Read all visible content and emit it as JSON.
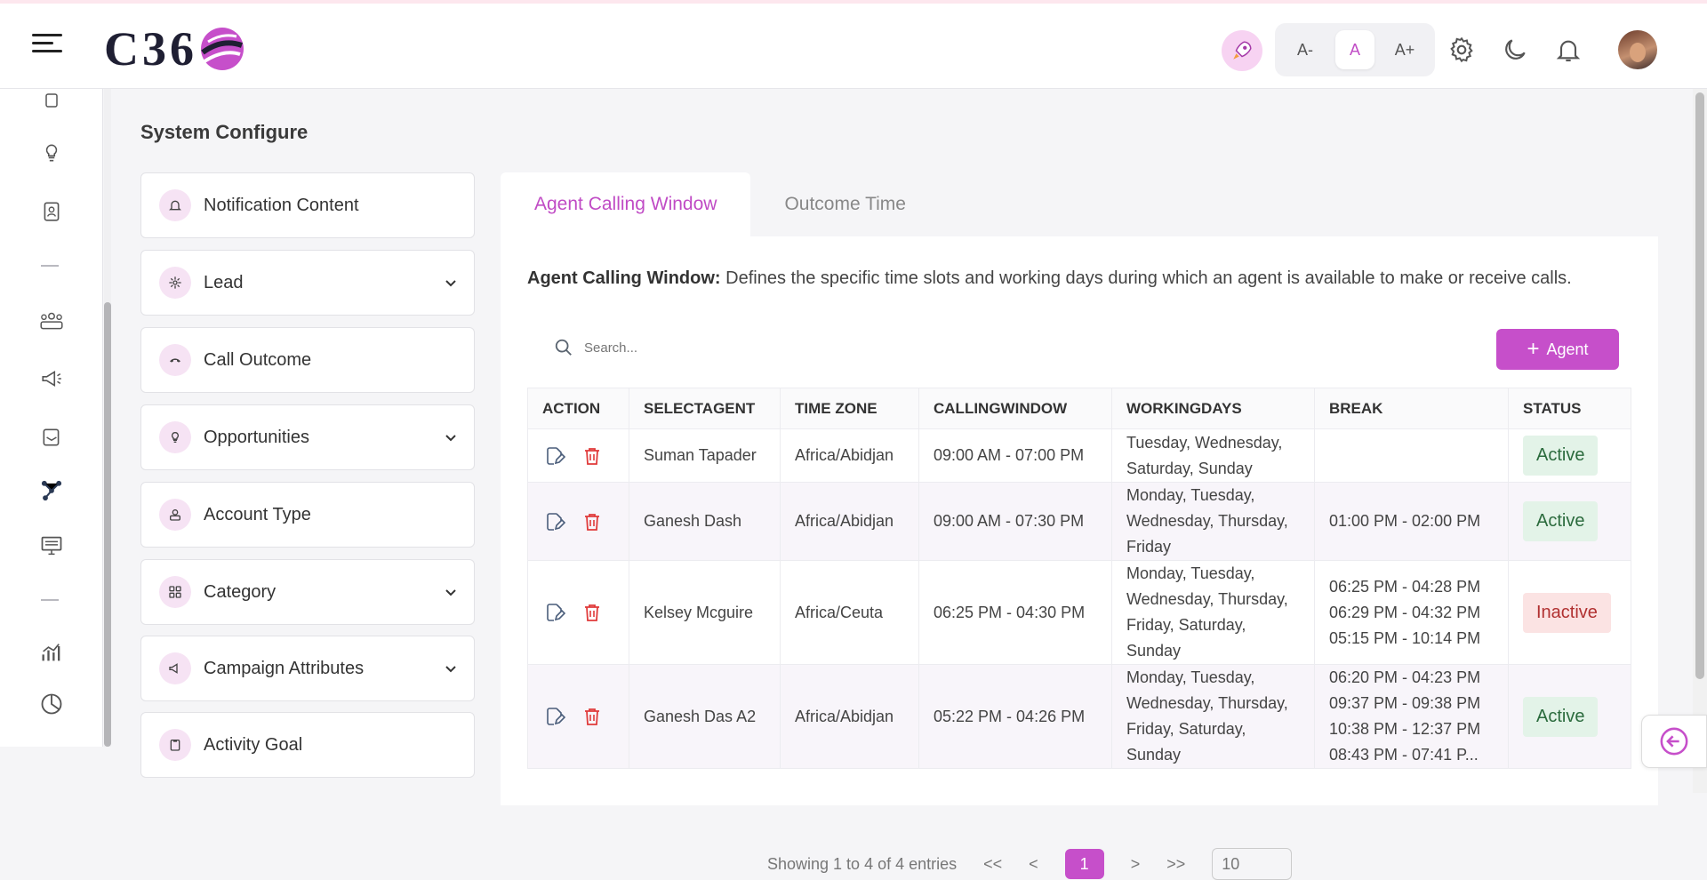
{
  "header": {
    "logo_text": "C36",
    "font_controls": [
      "A-",
      "A",
      "A+"
    ],
    "active_font": "A"
  },
  "page": {
    "title": "System Configure"
  },
  "config_menu": [
    {
      "label": "Notification Content",
      "icon": "bell-icon",
      "has_dropdown": false
    },
    {
      "label": "Lead",
      "icon": "network-icon",
      "has_dropdown": true
    },
    {
      "label": "Call Outcome",
      "icon": "phone-icon",
      "has_dropdown": false
    },
    {
      "label": "Opportunities",
      "icon": "bulb-icon",
      "has_dropdown": true
    },
    {
      "label": "Account Type",
      "icon": "user-card-icon",
      "has_dropdown": false
    },
    {
      "label": "Category",
      "icon": "grid-icon",
      "has_dropdown": true
    },
    {
      "label": "Campaign Attributes",
      "icon": "megaphone-icon",
      "has_dropdown": true
    },
    {
      "label": "Activity Goal",
      "icon": "clipboard-icon",
      "has_dropdown": false
    }
  ],
  "tabs": [
    {
      "label": "Agent Calling Window",
      "active": true
    },
    {
      "label": "Outcome Time",
      "active": false
    }
  ],
  "description": {
    "title": "Agent Calling Window:",
    "text": "Defines the specific time slots and working days during which an agent is available to make or receive calls."
  },
  "search": {
    "placeholder": "Search..."
  },
  "add_button": {
    "label": "Agent"
  },
  "table": {
    "columns": [
      "ACTION",
      "SELECTAGENT",
      "TIME ZONE",
      "CALLINGWINDOW",
      "WORKINGDAYS",
      "BREAK",
      "STATUS"
    ],
    "rows": [
      {
        "agent": "Suman Tapader",
        "timezone": "Africa/Abidjan",
        "window": "09:00 AM - 07:00 PM",
        "days": "Tuesday, Wednesday, Saturday, Sunday",
        "breaks": [],
        "status": "Active"
      },
      {
        "agent": "Ganesh Dash",
        "timezone": "Africa/Abidjan",
        "window": "09:00 AM - 07:30 PM",
        "days": "Monday, Tuesday, Wednesday, Thursday, Friday",
        "breaks": [
          "01:00 PM - 02:00 PM"
        ],
        "status": "Active"
      },
      {
        "agent": "Kelsey Mcguire",
        "timezone": "Africa/Ceuta",
        "window": "06:25 PM - 04:30 PM",
        "days": "Monday, Tuesday, Wednesday, Thursday, Friday, Saturday, Sunday",
        "breaks": [
          "06:25 PM - 04:28 PM",
          "06:29 PM - 04:32 PM",
          "05:15 PM - 10:14 PM"
        ],
        "status": "Inactive"
      },
      {
        "agent": "Ganesh Das A2",
        "timezone": "Africa/Abidjan",
        "window": "05:22 PM - 04:26 PM",
        "days": "Monday, Tuesday, Wednesday, Thursday, Friday, Saturday, Sunday",
        "breaks": [
          "06:20 PM - 04:23 PM",
          "09:37 PM - 09:38 PM",
          "10:38 PM - 12:37 PM",
          "08:43 PM - 07:41 P..."
        ],
        "status": "Active"
      }
    ]
  },
  "pagination": {
    "summary": "Showing 1 to 4 of 4 entries",
    "first": "<<",
    "prev": "<",
    "current": "1",
    "next": ">",
    "last": ">>",
    "page_size": "10"
  },
  "colors": {
    "accent": "#c64fca",
    "active_bg": "#e3f3e8",
    "inactive_bg": "#fbe3e3"
  }
}
